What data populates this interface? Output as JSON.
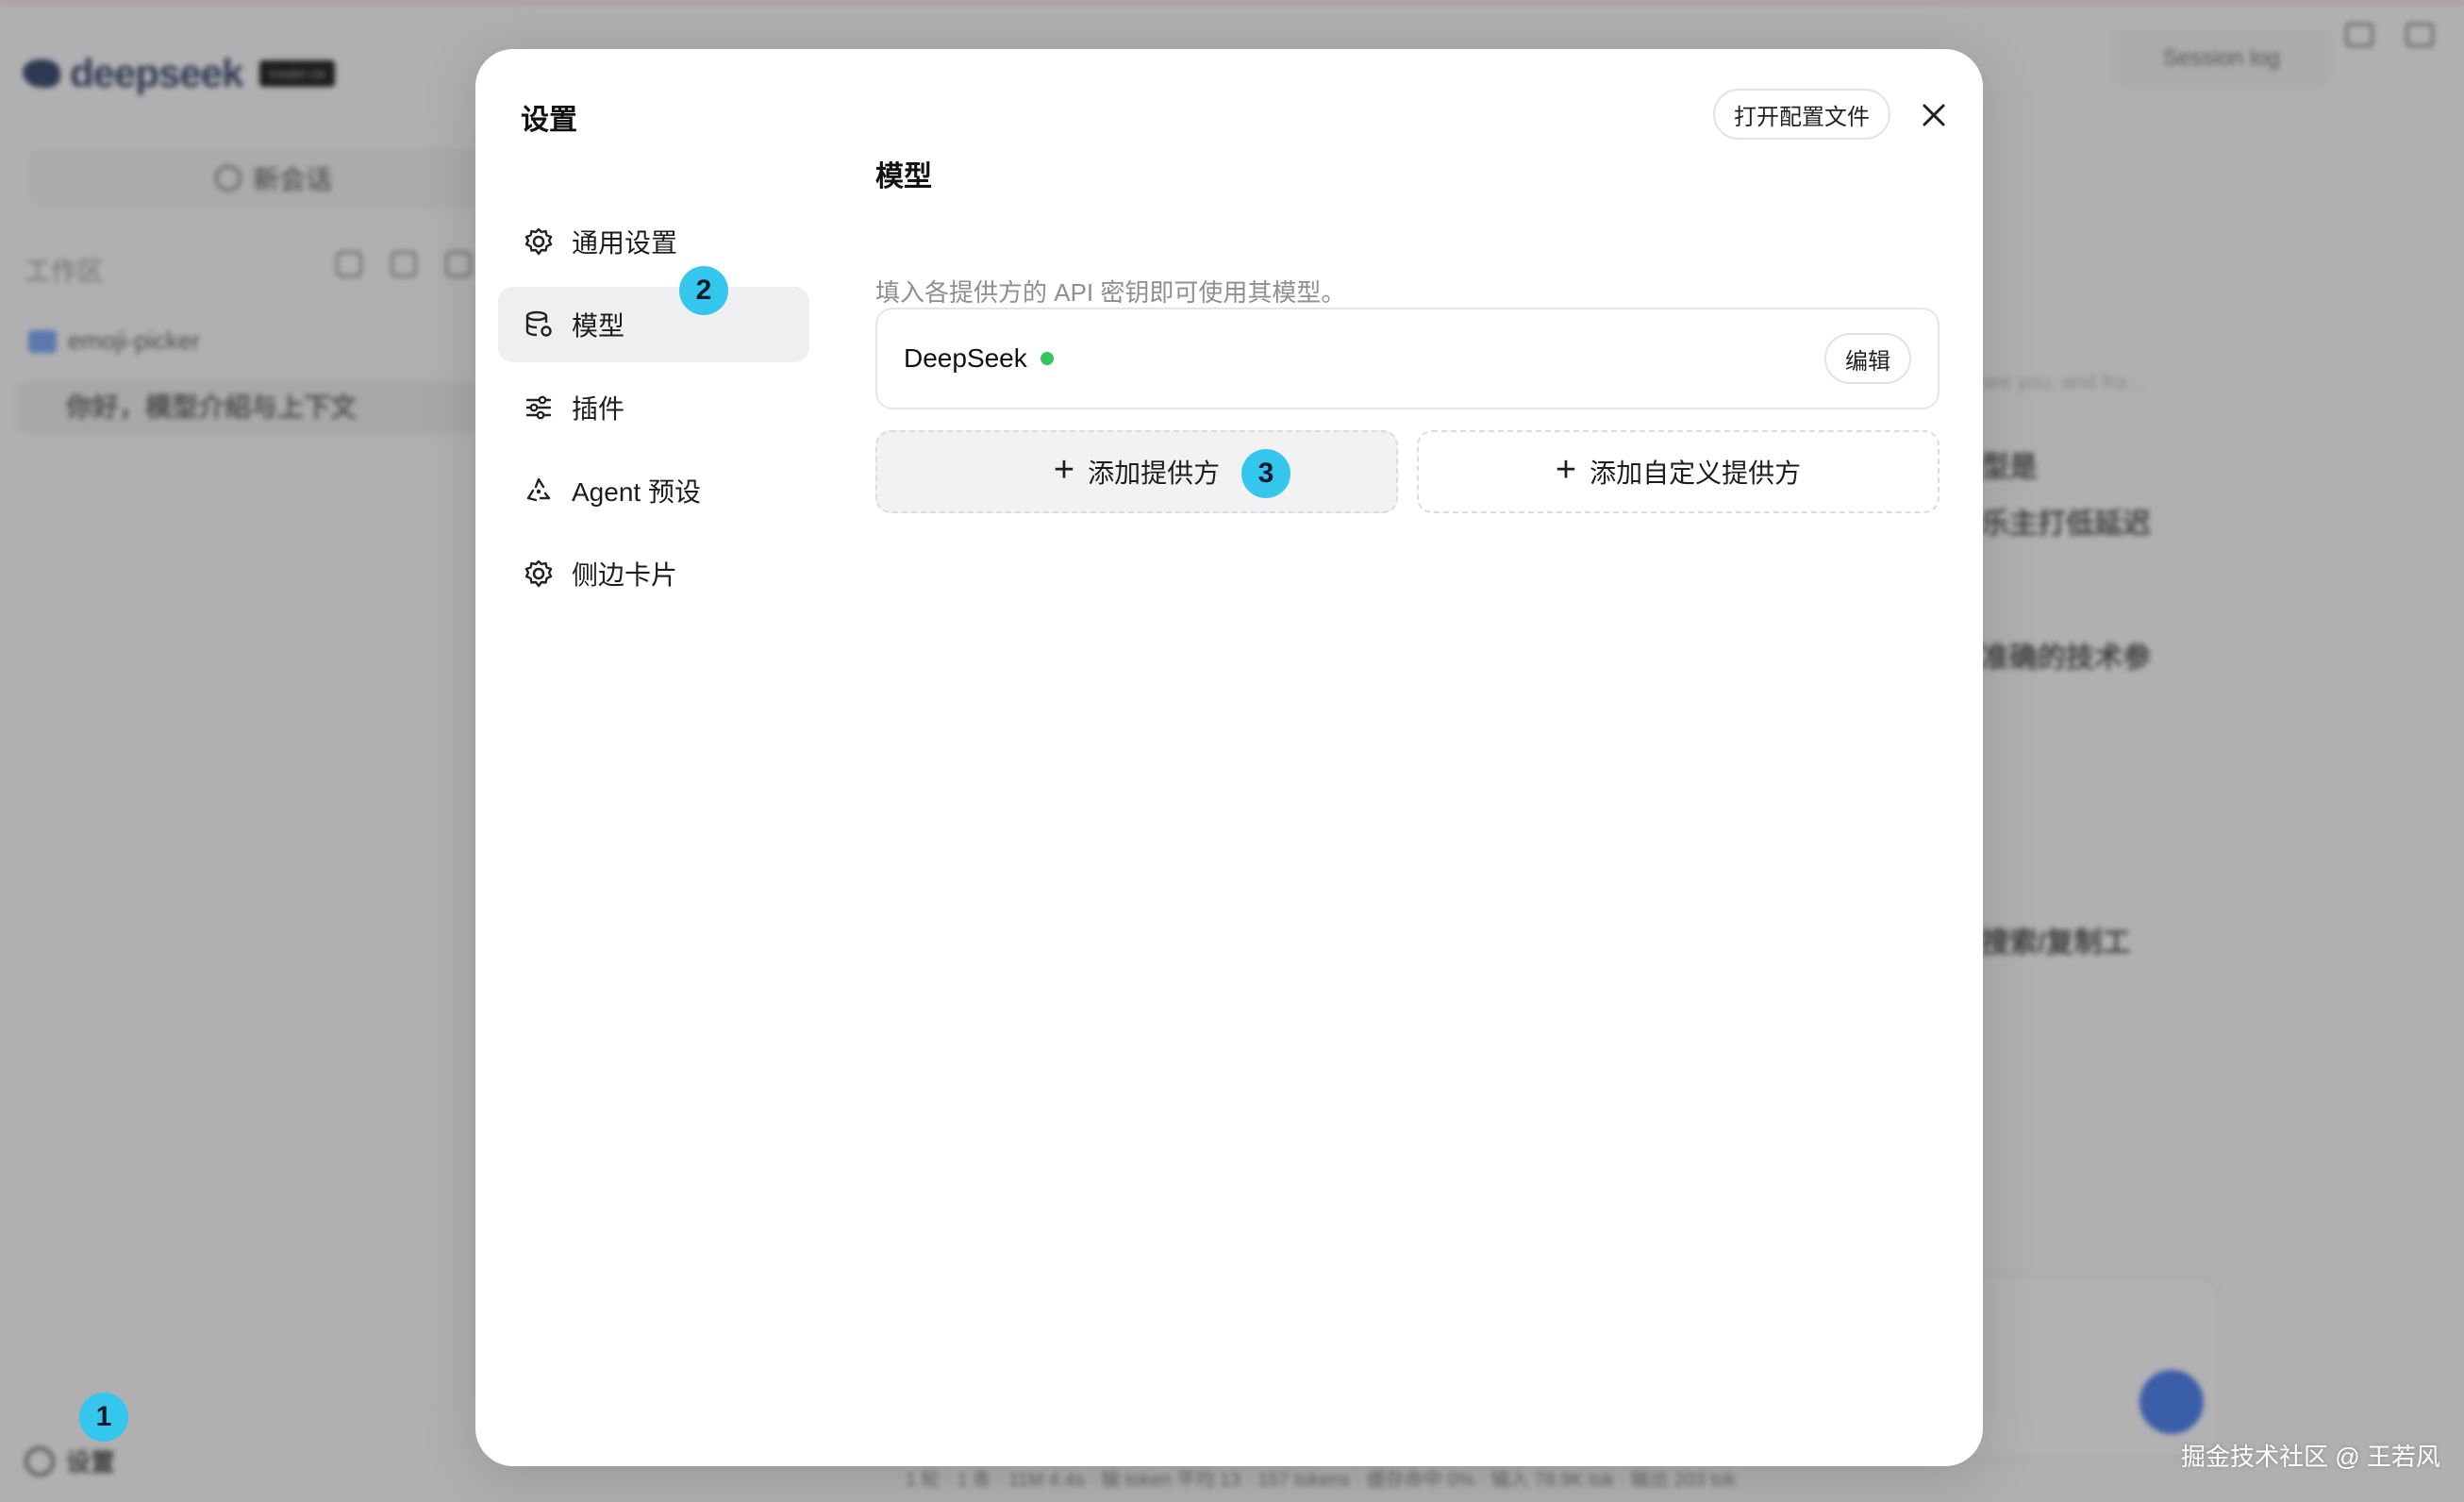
{
  "background": {
    "brand": "deepseek",
    "brand_badge": "model ctx",
    "new_chat": "新会话",
    "workspace_label": "工作区",
    "folder": "emoji-picker",
    "session": "你好，模型介绍与上下文",
    "session_log": "Session log",
    "right_fragments": [
      "型是",
      "乐主打低延迟",
      "准确的技术参",
      "搜索/复制工"
    ],
    "right_muted": "are you, and fro...",
    "bottom_status": "1 轮 · 1 条 · 11M 4.4s · 输 token 平均 13 · 157 tokens · 缓存命中 0% · 输入 78.9K tok · 输出 203 tok",
    "settings_label": "设置"
  },
  "steps": {
    "one": "1",
    "two": "2",
    "three": "3"
  },
  "modal": {
    "title": "设置",
    "open_config": "打开配置文件",
    "nav": [
      {
        "label": "通用设置",
        "icon": "gear-icon"
      },
      {
        "label": "模型",
        "icon": "database-gear-icon"
      },
      {
        "label": "插件",
        "icon": "sliders-icon"
      },
      {
        "label": "Agent 预设",
        "icon": "recycle-icon"
      },
      {
        "label": "侧边卡片",
        "icon": "gear-icon"
      }
    ],
    "active_nav": "模型",
    "content_title": "模型",
    "content_desc": "填入各提供方的 API 密钥即可使用其模型。",
    "provider": {
      "name": "DeepSeek",
      "status_color": "#34c759",
      "edit_label": "编辑"
    },
    "add_provider": "添加提供方",
    "add_custom_provider": "添加自定义提供方"
  },
  "watermark": "掘金技术社区 @ 王若风",
  "colors": {
    "step_badge": "#35c6ee",
    "status_ok": "#34c759",
    "active_nav_bg": "#efeff1"
  }
}
